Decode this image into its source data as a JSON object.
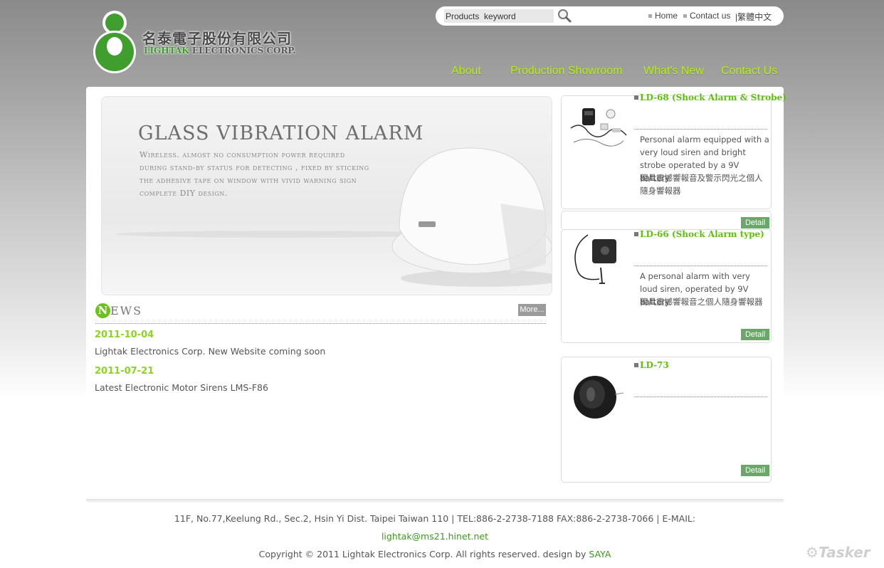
{
  "header": {
    "logo_cn": "名泰電子股份有限公司",
    "logo_en_brand": "LIGHTAK",
    "logo_en_rest": " ELECTRONICS CORP.",
    "brand_color": "#3b9a2a"
  },
  "topbar": {
    "search_value": "Products  keyword",
    "links": [
      "Home",
      "Contact us",
      "|繁體中文"
    ]
  },
  "nav": {
    "items": [
      "About",
      "Production Showroom",
      "What's New",
      "Contact Us"
    ],
    "color": "#b6f20a"
  },
  "banner": {
    "title": "GLASS VIBRATION ALARM",
    "description": "Wireless. almost no consumption power required during stand-by status for detecting , fixed by sticking the adhesive tape on window with vivid warning sign complete DIY design."
  },
  "news": {
    "heading_initial": "N",
    "heading_rest": "EWS",
    "more_label": "More...",
    "items": [
      {
        "date": "2011-10-04",
        "title": "Lightak Electronics Corp. New Website coming soon"
      },
      {
        "date": "2011-07-21",
        "title": "Latest Electronic Motor Sirens LMS-F86"
      }
    ]
  },
  "products": [
    {
      "name": "LD-68 (Shock Alarm & Strobe)",
      "desc_en": "Personal alarm equipped with a very loud siren and bright strobe operated by a 9V battery.",
      "desc_cn": "獨具震撼響報音及警示閃光之個人隨身響報器",
      "detail_label": "Detail"
    },
    {
      "name": "LD-66 (Shock Alarm type)",
      "desc_en": "A personal alarm with very loud siren, operated by 9V battery.",
      "desc_cn": "獨具震撼響報音之個人隨身響報器",
      "detail_label": "Detail"
    },
    {
      "name": "LD-73",
      "desc_en": "",
      "desc_cn": "",
      "detail_label": "Detail"
    }
  ],
  "footer": {
    "address": "11F, No.77,Keelung Rd., Sec.2, Hsin Yi Dist. Taipei Taiwan 110 | TEL:886-2-2738-7188 FAX:886-2-2738-7066 | E-MAIL:",
    "email": "lightak@ms21.hinet.net",
    "copyright": "Copyright © 2011 Lightak Electronics Corp. All rights reserved. design by",
    "designer": "SAYA"
  },
  "watermark": "Tasker"
}
